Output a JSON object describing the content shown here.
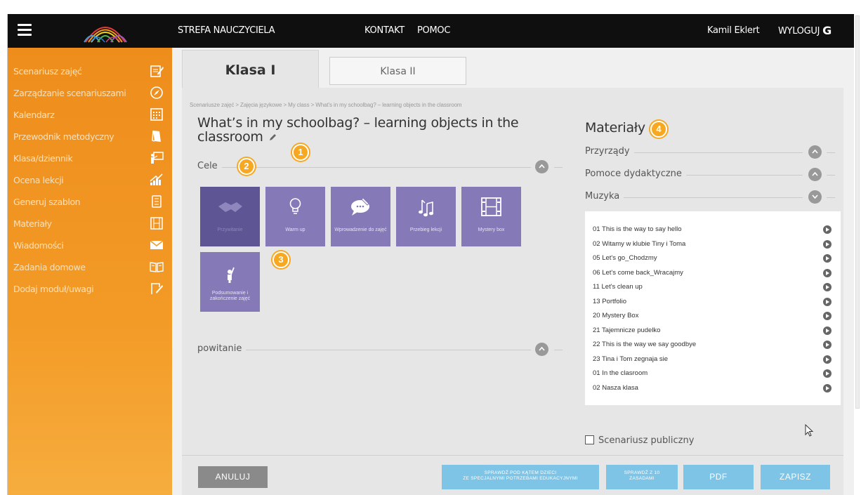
{
  "topbar": {
    "menu_icon": "hamburger-menu-icon",
    "logo_icon": "rainbow-arches-logo",
    "teacher_zone": "STREFA NAUCZYCIELA",
    "contact": "KONTAKT",
    "help": "POMOC",
    "user": "Kamil Eklert",
    "logout": "WYLOGUJ",
    "logout_icon": "logout-icon"
  },
  "sidebar": {
    "items": [
      {
        "label": "Scenariusz zajęć",
        "icon": "edit-note-icon"
      },
      {
        "label": "Zarządzanie scenariuszami",
        "icon": "compass-icon"
      },
      {
        "label": "Kalendarz",
        "icon": "calendar-icon"
      },
      {
        "label": "Przewodnik metodyczny",
        "icon": "book-icon"
      },
      {
        "label": "Klasa/dziennik",
        "icon": "classroom-board-icon"
      },
      {
        "label": "Ocena lekcji",
        "icon": "chart-up-icon"
      },
      {
        "label": "Generuj szablon",
        "icon": "template-list-icon"
      },
      {
        "label": "Materiały",
        "icon": "film-strip-icon"
      },
      {
        "label": "Wiadomości",
        "icon": "envelope-icon"
      },
      {
        "label": "Zadania domowe",
        "icon": "open-book-icon"
      },
      {
        "label": "Dodaj moduł/uwagi",
        "icon": "add-note-icon"
      }
    ]
  },
  "tabs": {
    "klasa1": "Klasa I",
    "klasa2": "Klasa II"
  },
  "breadcrumb": "Scenariusze zajęć  >  Zajęcia językowe  >  My class  >  What's in my schoolbag? – learning objects in the classroom",
  "scenario": {
    "title": "What’s in my schoolbag? – learning objects in the classroom",
    "goals_label": "Cele",
    "greeting_label": "powitanie"
  },
  "badges": [
    "1",
    "2",
    "3",
    "4"
  ],
  "tiles": [
    {
      "label": "Przywitanie",
      "icon": "handshake-icon",
      "dim": true
    },
    {
      "label": "Warm up",
      "icon": "lightbulb-icon",
      "dim": false
    },
    {
      "label": "Wprowadzenie do zajęć",
      "icon": "speech-bubble-icon",
      "dim": false
    },
    {
      "label": "Przebieg lekcji",
      "icon": "music-notes-icon",
      "dim": false
    },
    {
      "label": "Mystery box",
      "icon": "film-strip-icon",
      "dim": false
    },
    {
      "label": "Podsumowanie i zakończenie zajęć",
      "icon": "person-pointing-icon",
      "dim": false
    }
  ],
  "materials": {
    "title": "Materiały",
    "sections": [
      "Przyrządy",
      "Pomoce dydaktyczne",
      "Muzyka"
    ],
    "tracks": [
      "01 This is the way to say hello",
      "02 Witamy w klubie Tiny i Toma",
      "05 Let's go_Chodzmy",
      "06 Let's come back_Wracajmy",
      "11 Let's clean up",
      "13 Portfolio",
      "20 Mystery Box",
      "21 Tajemnicze pudelko",
      "22 This is the way we say goodbye",
      "23 Tina i Tom zegnaja sie",
      "01 In the clasroom",
      "02 Nasza klasa"
    ],
    "public_label": "Scenariusz publiczny"
  },
  "buttons": {
    "cancel": "ANULUJ",
    "check_special_1": "SPRAWDŹ POD KĄTEM DZIECI",
    "check_special_2": "ZE SPECJALNYMI POTRZEBAMI EDUKACYJNYMI",
    "check10_1": "SPRAWDŹ Z 10",
    "check10_2": "ZASADAMI",
    "pdf": "PDF",
    "save": "ZAPISZ"
  },
  "colors": {
    "sidebar": "#f39a26",
    "tile": "#8579b7",
    "badge": "#f7a823",
    "button_blue": "#7ec4e6",
    "button_gray": "#8a8a8a"
  }
}
